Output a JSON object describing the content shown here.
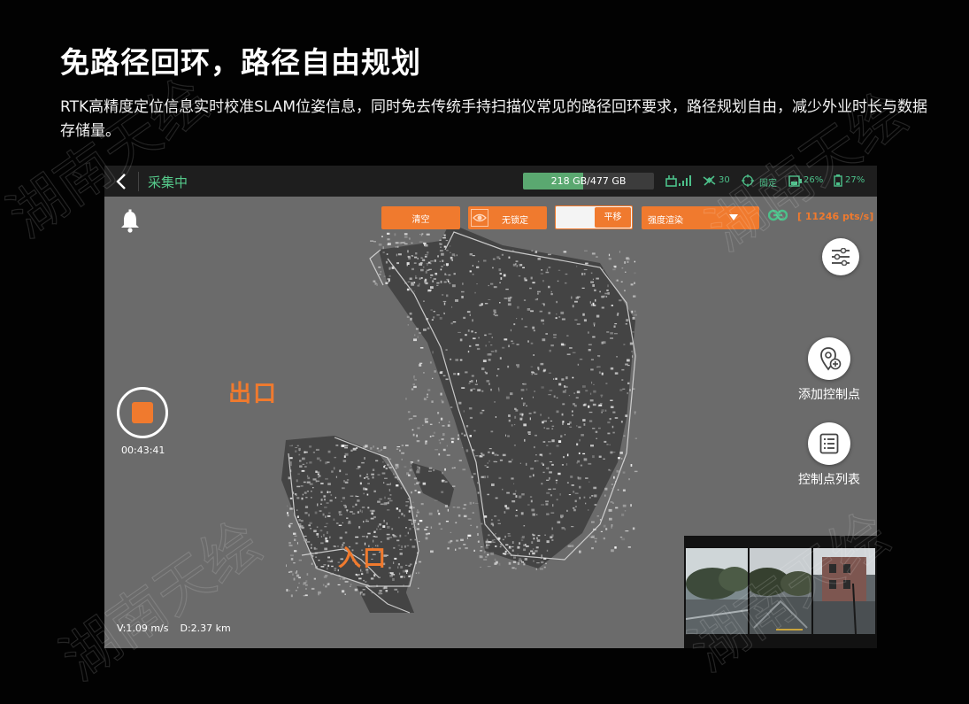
{
  "headline": "免路径回环，路径自由规划",
  "description": "RTK高精度定位信息实时校准SLAM位姿信息，同时免去传统手持扫描仪常见的路径回环要求，路径规划自由，减少外业时长与数据存储量。",
  "status_bar": {
    "back_icon": "chevron-left-icon",
    "title": "采集中",
    "storage": {
      "text": "218 GB/477 GB",
      "used_fraction": 0.457
    },
    "satellites": "30",
    "fix_status": "固定",
    "battery_1": "26%",
    "battery_2": "27%"
  },
  "toolbar": {
    "clear_label": "清空",
    "lock_label": "无锁定",
    "view_mode_selected": "平移",
    "render_select_value": "强度渲染",
    "points_rate": "[ 11246 pts/s]"
  },
  "side_buttons": {
    "add_control_point": "添加控制点",
    "control_point_list": "控制点列表"
  },
  "recording": {
    "elapsed": "00:43:41"
  },
  "map_labels": {
    "exit": "出口",
    "entrance": "入口"
  },
  "telemetry": {
    "velocity": "V:1.09 m/s",
    "distance": "D:2.37 km"
  },
  "colors": {
    "accent": "#f07a2e",
    "status_green": "#55c98a",
    "map_bg": "#6b6b6b"
  }
}
